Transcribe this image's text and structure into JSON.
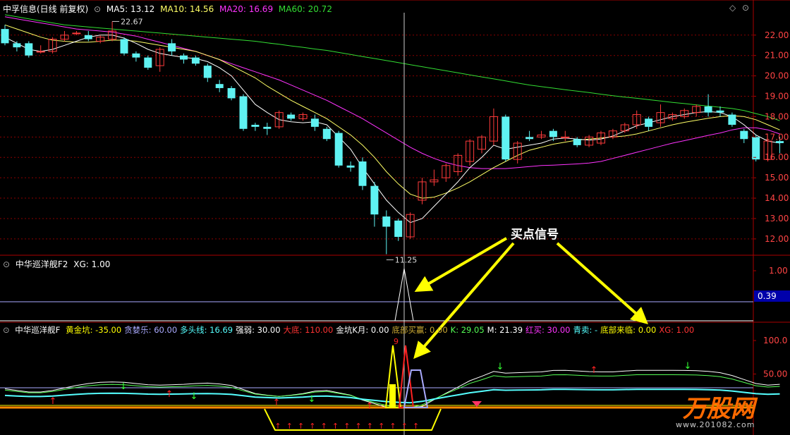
{
  "colors": {
    "up": "#ff3b3b",
    "down": "#5ff2f2",
    "ma5": "#ffffff",
    "ma10": "#ffff66",
    "ma20": "#ff33ff",
    "ma60": "#33dd33",
    "grid": "#8b0000",
    "border": "#aa0000",
    "arrow": "#ffff00"
  },
  "panel1": {
    "title": "中孚信息(日线 前复权)",
    "ma5_label": "MA5: 13.12",
    "ma10_label": "MA10: 14.56",
    "ma20_label": "MA20: 16.69",
    "ma60_label": "MA60: 20.72",
    "high_label": "22.67",
    "low_label": "11.25",
    "y_ticks": [
      "22.00",
      "21.00",
      "20.00",
      "19.00",
      "18.00",
      "17.00",
      "16.00",
      "15.00",
      "14.00",
      "13.00",
      "12.00"
    ]
  },
  "panel2": {
    "title": "中华巡洋舰F2",
    "xg_label": "XG: 1.00",
    "y_tick": "1.00",
    "value_box": "0.39"
  },
  "panel3": {
    "title": "中华巡洋舰F",
    "items": [
      {
        "text": "黄金坑: -35.00",
        "color": "#ffff00"
      },
      {
        "text": "贪婪乐: 60.00",
        "color": "#aaaaff"
      },
      {
        "text": "多头线: 16.69",
        "color": "#55ffff"
      },
      {
        "text": "强弱: 30.00",
        "color": "#ffffff"
      },
      {
        "text": "大底: 110.00",
        "color": "#ff3333"
      },
      {
        "text": "金坑K月: 0.00",
        "color": "#ffffff"
      },
      {
        "text": "底部买赢: 0.00",
        "color": "#ccaa33"
      },
      {
        "text": "K: 29.05",
        "color": "#55ff55"
      },
      {
        "text": "M: 21.39",
        "color": "#ffffff"
      },
      {
        "text": "红买: 30.00",
        "color": "#ff33ff"
      },
      {
        "text": "青卖: -",
        "color": "#55ffff"
      },
      {
        "text": "底部来临: 0.00",
        "color": "#ffff00"
      },
      {
        "text": "XG: 1.00",
        "color": "#ff3333"
      }
    ],
    "y_ticks": [
      "100.0",
      "50.00"
    ],
    "peak_label": "9"
  },
  "callout": "买点信号",
  "watermark": {
    "logo": "万股网",
    "url": "www.201082.com"
  },
  "chart_data": {
    "type": "candlestick",
    "title": "中孚信息(日线 前复权)",
    "ylim": [
      11.2,
      23.1
    ],
    "candles": [
      {
        "o": 22.3,
        "c": 21.6,
        "h": 22.5,
        "l": 21.5
      },
      {
        "o": 21.6,
        "c": 21.4,
        "h": 21.7,
        "l": 21.2
      },
      {
        "o": 21.6,
        "c": 21.0,
        "h": 21.7,
        "l": 20.9
      },
      {
        "o": 21.2,
        "c": 21.2,
        "h": 21.5,
        "l": 21.1
      },
      {
        "o": 21.2,
        "c": 21.8,
        "h": 21.9,
        "l": 21.1
      },
      {
        "o": 21.8,
        "c": 22.0,
        "h": 22.2,
        "l": 21.7
      },
      {
        "o": 22.1,
        "c": 22.1,
        "h": 22.2,
        "l": 22.0
      },
      {
        "o": 22.0,
        "c": 21.8,
        "h": 22.2,
        "l": 21.7
      },
      {
        "o": 21.7,
        "c": 21.9,
        "h": 22.0,
        "l": 21.6
      },
      {
        "o": 21.8,
        "c": 22.2,
        "h": 22.67,
        "l": 21.7
      },
      {
        "o": 21.8,
        "c": 21.1,
        "h": 21.9,
        "l": 21.0
      },
      {
        "o": 21.1,
        "c": 20.9,
        "h": 21.2,
        "l": 20.7
      },
      {
        "o": 20.9,
        "c": 20.4,
        "h": 21.0,
        "l": 20.3
      },
      {
        "o": 20.5,
        "c": 21.3,
        "h": 21.4,
        "l": 20.2
      },
      {
        "o": 21.6,
        "c": 21.2,
        "h": 21.8,
        "l": 21.0
      },
      {
        "o": 21.0,
        "c": 20.8,
        "h": 21.1,
        "l": 20.6
      },
      {
        "o": 20.9,
        "c": 20.6,
        "h": 21.0,
        "l": 20.5
      },
      {
        "o": 20.5,
        "c": 19.9,
        "h": 20.6,
        "l": 19.7
      },
      {
        "o": 19.6,
        "c": 19.4,
        "h": 19.8,
        "l": 19.2
      },
      {
        "o": 19.4,
        "c": 18.9,
        "h": 19.5,
        "l": 18.8
      },
      {
        "o": 19.0,
        "c": 17.4,
        "h": 19.1,
        "l": 17.3
      },
      {
        "o": 17.6,
        "c": 17.5,
        "h": 17.7,
        "l": 17.3
      },
      {
        "o": 17.5,
        "c": 17.4,
        "h": 17.7,
        "l": 17.1
      },
      {
        "o": 17.5,
        "c": 18.2,
        "h": 18.3,
        "l": 17.4
      },
      {
        "o": 18.1,
        "c": 17.9,
        "h": 18.2,
        "l": 17.8
      },
      {
        "o": 17.9,
        "c": 18.1,
        "h": 18.2,
        "l": 17.8
      },
      {
        "o": 17.9,
        "c": 17.5,
        "h": 18.1,
        "l": 17.3
      },
      {
        "o": 17.4,
        "c": 16.9,
        "h": 17.5,
        "l": 16.8
      },
      {
        "o": 17.2,
        "c": 15.6,
        "h": 17.3,
        "l": 15.5
      },
      {
        "o": 15.6,
        "c": 15.5,
        "h": 15.8,
        "l": 15.3
      },
      {
        "o": 15.8,
        "c": 14.6,
        "h": 16.0,
        "l": 14.4
      },
      {
        "o": 14.6,
        "c": 13.2,
        "h": 14.8,
        "l": 12.6
      },
      {
        "o": 13.1,
        "c": 12.6,
        "h": 13.4,
        "l": 11.25
      },
      {
        "o": 12.9,
        "c": 12.1,
        "h": 13.0,
        "l": 11.9
      },
      {
        "o": 12.1,
        "c": 13.2,
        "h": 13.3,
        "l": 12.0
      },
      {
        "o": 13.9,
        "c": 14.8,
        "h": 15.0,
        "l": 13.7
      },
      {
        "o": 14.8,
        "c": 14.9,
        "h": 15.4,
        "l": 14.6
      },
      {
        "o": 15.0,
        "c": 15.6,
        "h": 15.7,
        "l": 14.8
      },
      {
        "o": 15.3,
        "c": 16.1,
        "h": 16.2,
        "l": 15.1
      },
      {
        "o": 15.8,
        "c": 16.8,
        "h": 16.9,
        "l": 15.6
      },
      {
        "o": 16.4,
        "c": 17.0,
        "h": 17.1,
        "l": 16.2
      },
      {
        "o": 16.8,
        "c": 18.0,
        "h": 18.4,
        "l": 16.6
      },
      {
        "o": 18.0,
        "c": 15.9,
        "h": 18.1,
        "l": 15.8
      },
      {
        "o": 15.9,
        "c": 16.7,
        "h": 16.8,
        "l": 15.7
      },
      {
        "o": 17.0,
        "c": 16.9,
        "h": 17.3,
        "l": 16.8
      },
      {
        "o": 17.0,
        "c": 17.1,
        "h": 17.3,
        "l": 16.9
      },
      {
        "o": 17.3,
        "c": 17.0,
        "h": 17.4,
        "l": 16.8
      },
      {
        "o": 17.0,
        "c": 17.0,
        "h": 17.3,
        "l": 16.8
      },
      {
        "o": 16.9,
        "c": 16.6,
        "h": 17.0,
        "l": 16.5
      },
      {
        "o": 16.6,
        "c": 17.0,
        "h": 17.1,
        "l": 16.5
      },
      {
        "o": 16.7,
        "c": 17.2,
        "h": 17.3,
        "l": 16.6
      },
      {
        "o": 17.0,
        "c": 17.3,
        "h": 17.4,
        "l": 16.9
      },
      {
        "o": 17.3,
        "c": 17.6,
        "h": 17.7,
        "l": 17.2
      },
      {
        "o": 17.6,
        "c": 18.1,
        "h": 18.3,
        "l": 17.4
      },
      {
        "o": 17.9,
        "c": 17.5,
        "h": 18.0,
        "l": 17.3
      },
      {
        "o": 17.7,
        "c": 18.2,
        "h": 18.6,
        "l": 17.5
      },
      {
        "o": 17.9,
        "c": 18.1,
        "h": 18.2,
        "l": 17.8
      },
      {
        "o": 18.0,
        "c": 18.3,
        "h": 18.4,
        "l": 17.9
      },
      {
        "o": 18.2,
        "c": 18.5,
        "h": 18.6,
        "l": 18.0
      },
      {
        "o": 18.5,
        "c": 18.2,
        "h": 19.1,
        "l": 18.0
      },
      {
        "o": 18.3,
        "c": 18.2,
        "h": 18.5,
        "l": 18.0
      },
      {
        "o": 18.1,
        "c": 17.6,
        "h": 18.2,
        "l": 17.5
      },
      {
        "o": 17.3,
        "c": 16.9,
        "h": 17.4,
        "l": 16.7
      },
      {
        "o": 17.0,
        "c": 15.9,
        "h": 17.1,
        "l": 15.8
      },
      {
        "o": 15.9,
        "c": 16.8,
        "h": 16.9,
        "l": 15.8
      },
      {
        "o": 16.8,
        "c": 16.7,
        "h": 17.0,
        "l": 16.2
      }
    ],
    "series": [
      {
        "name": "MA60",
        "values": [
          23.0,
          22.9,
          22.8,
          22.7,
          22.6,
          22.5,
          22.45,
          22.4,
          22.35,
          22.3,
          22.25,
          22.2,
          22.15,
          22.1,
          22.05,
          22.0,
          21.95,
          21.9,
          21.85,
          21.8,
          21.75,
          21.7,
          21.62,
          21.55,
          21.47,
          21.4,
          21.32,
          21.25,
          21.15,
          21.05,
          20.95,
          20.85,
          20.75,
          20.65,
          20.55,
          20.45,
          20.35,
          20.25,
          20.15,
          20.05,
          19.95,
          19.85,
          19.75,
          19.65,
          19.55,
          19.47,
          19.4,
          19.32,
          19.25,
          19.18,
          19.1,
          19.03,
          18.96,
          18.9,
          18.83,
          18.77,
          18.7,
          18.64,
          18.58,
          18.52,
          18.46,
          18.4,
          18.3,
          18.15,
          18.0,
          17.8
        ]
      },
      {
        "name": "MA20",
        "values": [
          22.9,
          22.8,
          22.7,
          22.6,
          22.5,
          22.4,
          22.3,
          22.25,
          22.2,
          22.15,
          22.05,
          21.95,
          21.8,
          21.65,
          21.5,
          21.35,
          21.2,
          21.0,
          20.8,
          20.6,
          20.4,
          20.2,
          20.0,
          19.8,
          19.55,
          19.3,
          19.05,
          18.8,
          18.5,
          18.2,
          17.9,
          17.55,
          17.2,
          16.85,
          16.5,
          16.2,
          15.95,
          15.75,
          15.6,
          15.5,
          15.45,
          15.45,
          15.45,
          15.5,
          15.55,
          15.6,
          15.62,
          15.65,
          15.68,
          15.72,
          15.8,
          15.95,
          16.1,
          16.25,
          16.4,
          16.55,
          16.7,
          16.82,
          16.95,
          17.08,
          17.2,
          17.35,
          17.45,
          17.45,
          17.35,
          17.15
        ]
      },
      {
        "name": "MA10",
        "values": [
          22.5,
          22.3,
          22.1,
          21.9,
          21.75,
          21.7,
          21.65,
          21.65,
          21.7,
          21.75,
          21.75,
          21.7,
          21.6,
          21.5,
          21.4,
          21.3,
          21.2,
          21.0,
          20.8,
          20.5,
          20.2,
          19.9,
          19.5,
          19.15,
          18.8,
          18.5,
          18.2,
          17.9,
          17.5,
          17.1,
          16.6,
          16.0,
          15.3,
          14.7,
          14.2,
          14.0,
          14.05,
          14.25,
          14.5,
          14.8,
          15.15,
          15.5,
          15.8,
          16.1,
          16.35,
          16.5,
          16.65,
          16.75,
          16.85,
          16.9,
          16.95,
          17.0,
          17.05,
          17.15,
          17.3,
          17.45,
          17.6,
          17.72,
          17.82,
          17.92,
          18.0,
          18.05,
          18.0,
          17.85,
          17.6,
          17.35
        ]
      },
      {
        "name": "MA5",
        "values": [
          21.9,
          21.6,
          21.3,
          21.2,
          21.3,
          21.5,
          21.7,
          21.9,
          22.0,
          22.0,
          21.85,
          21.6,
          21.3,
          21.1,
          21.0,
          20.9,
          20.85,
          20.7,
          20.4,
          20.0,
          19.3,
          18.6,
          18.2,
          17.85,
          17.75,
          17.7,
          17.75,
          17.6,
          17.0,
          16.4,
          15.5,
          14.7,
          13.9,
          13.3,
          12.8,
          13.0,
          13.6,
          14.2,
          14.8,
          15.5,
          16.0,
          16.6,
          16.4,
          16.5,
          16.6,
          16.7,
          16.9,
          16.95,
          16.9,
          16.85,
          16.9,
          17.05,
          17.3,
          17.55,
          17.7,
          17.85,
          18.0,
          18.1,
          18.2,
          18.25,
          18.2,
          18.0,
          17.6,
          17.1,
          16.8,
          16.7
        ]
      }
    ]
  }
}
